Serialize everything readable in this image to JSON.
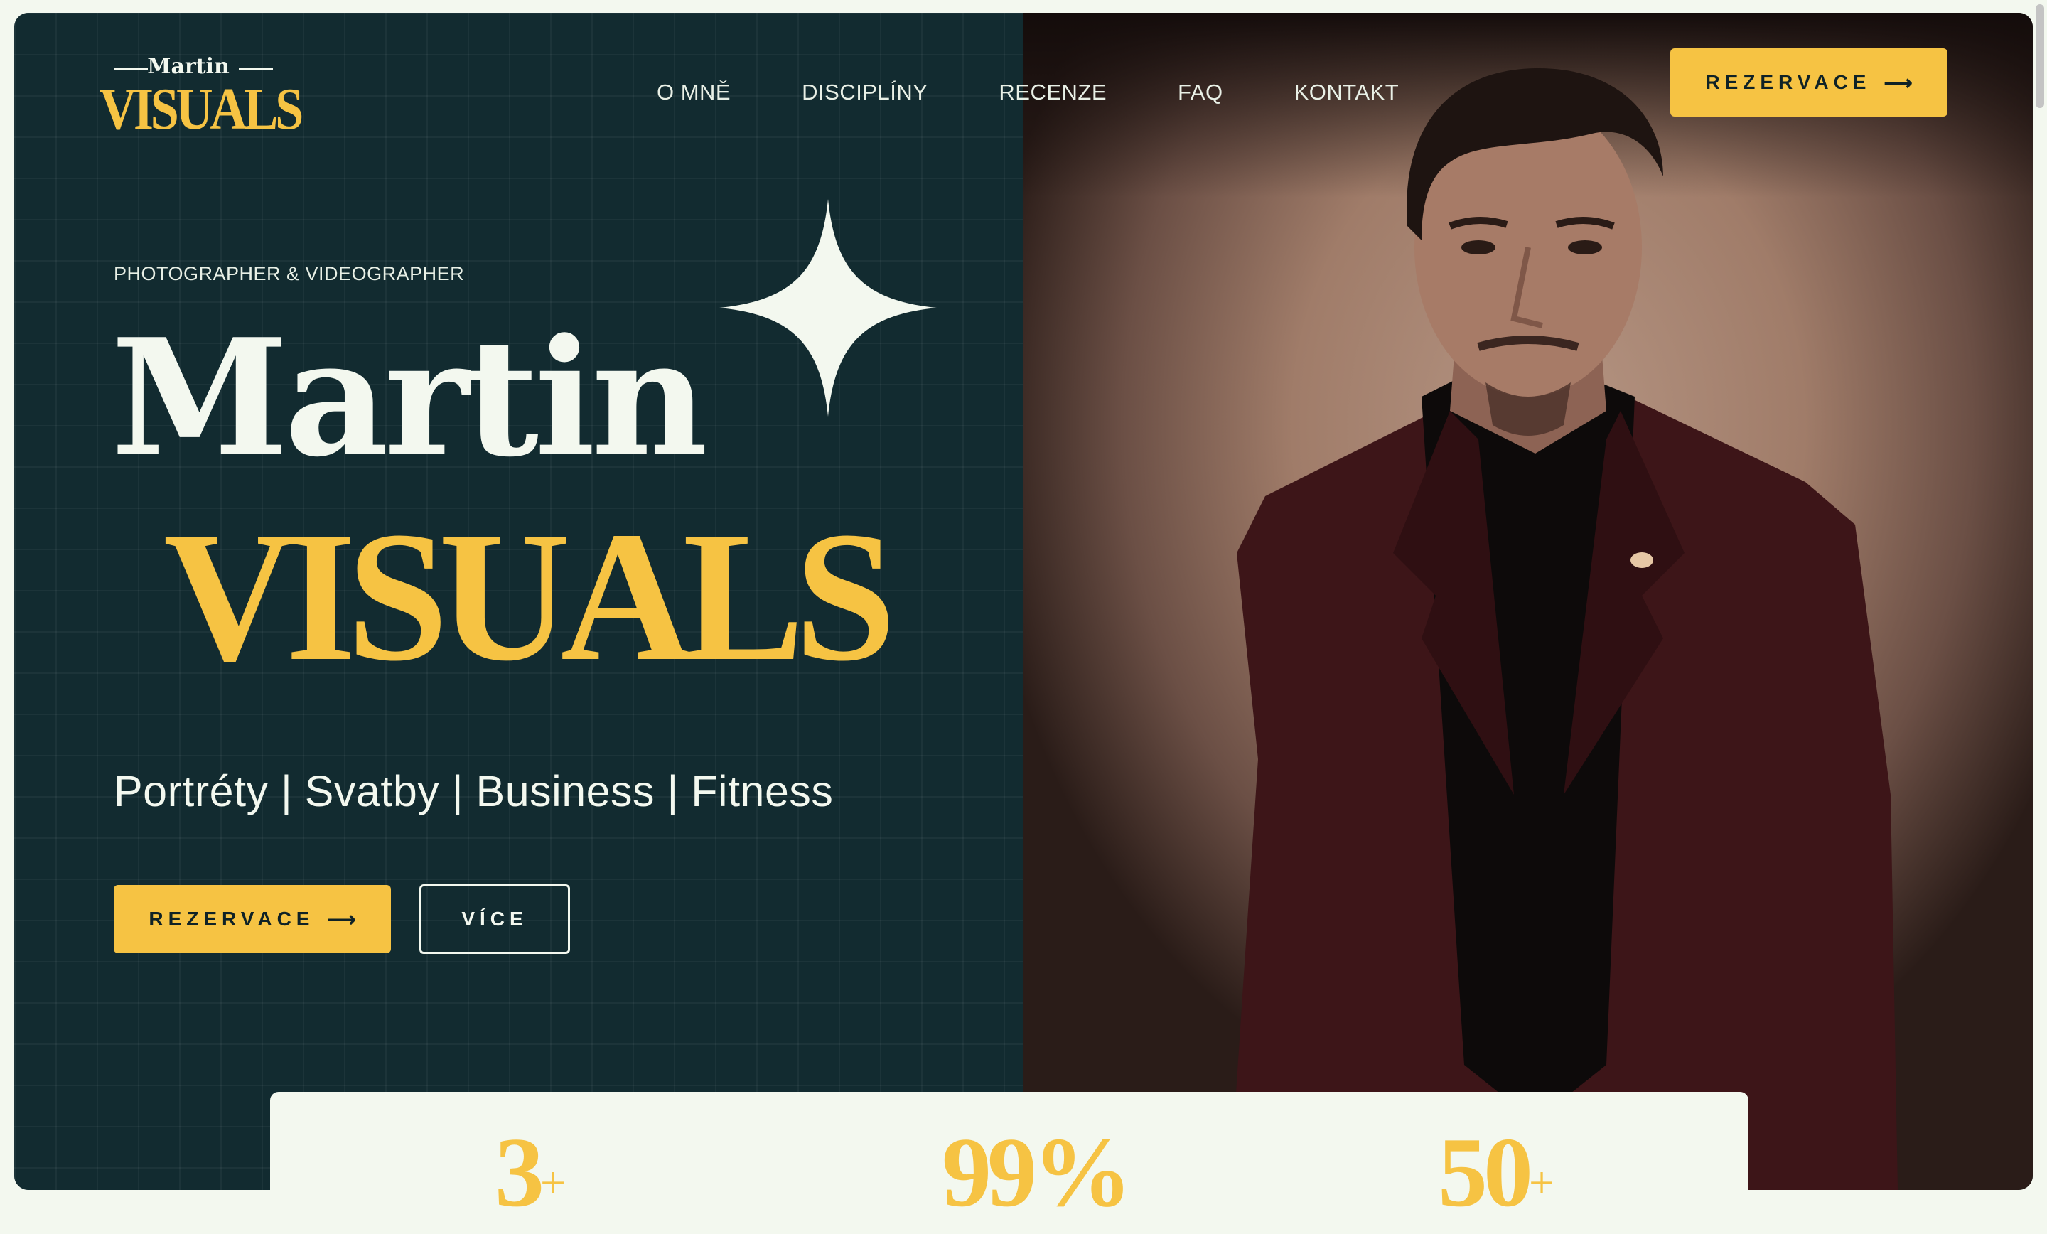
{
  "logo": {
    "top": "Martin",
    "main": "VISUALS"
  },
  "nav": {
    "items": [
      "O MNĚ",
      "DISCIPLÍNY",
      "RECENZE",
      "FAQ",
      "KONTAKT"
    ]
  },
  "header": {
    "cta_label": "REZERVACE"
  },
  "hero": {
    "eyebrow": "PHOTOGRAPHER & VIDEOGRAPHER",
    "title_line1": "Martin",
    "title_line2": "VISUALS",
    "tagline": "Portréty | Svatby | Business | Fitness",
    "primary_button": "REZERVACE",
    "secondary_button": "VÍCE"
  },
  "stats": [
    {
      "value": "3",
      "suffix": "+"
    },
    {
      "value": "99%",
      "suffix": ""
    },
    {
      "value": "50",
      "suffix": "+"
    }
  ],
  "icons": {
    "arrow": "arrow-right-icon",
    "sparkle": "sparkle-icon"
  },
  "colors": {
    "accent": "#f6c343",
    "dark": "#122b30",
    "light": "#f3f8ef",
    "jacket": "#3d1518"
  }
}
